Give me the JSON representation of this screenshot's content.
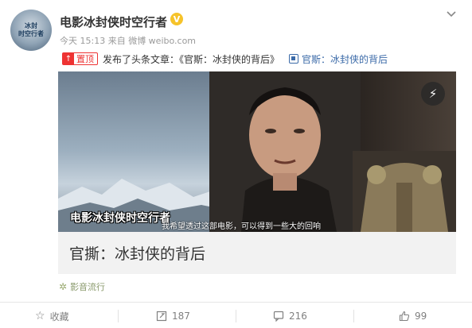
{
  "header": {
    "avatar_text": "冰封\n时空行者",
    "username": "电影冰封侠时空行者",
    "verified_mark": "V",
    "meta": "今天 15:13 来自 微博 weibo.com"
  },
  "post": {
    "top_badge": "置顶",
    "text": "发布了头条文章：《官斯：冰封侠的背后》",
    "link_text": "官斯：冰封侠的背后"
  },
  "card": {
    "watermark": "电影冰封侠时空行者",
    "subtitle": "我希望透过这部电影，可以得到一些大的回响",
    "title": "官撕：冰封侠的背后",
    "play_icon": "lightning-icon"
  },
  "source": {
    "label": "影音流行"
  },
  "actions": {
    "favorite": "收藏",
    "repost": "187",
    "comment": "216",
    "like": "99"
  },
  "colors": {
    "link": "#3b6aa8",
    "badge": "#e33333",
    "verified": "#f6c32a"
  }
}
